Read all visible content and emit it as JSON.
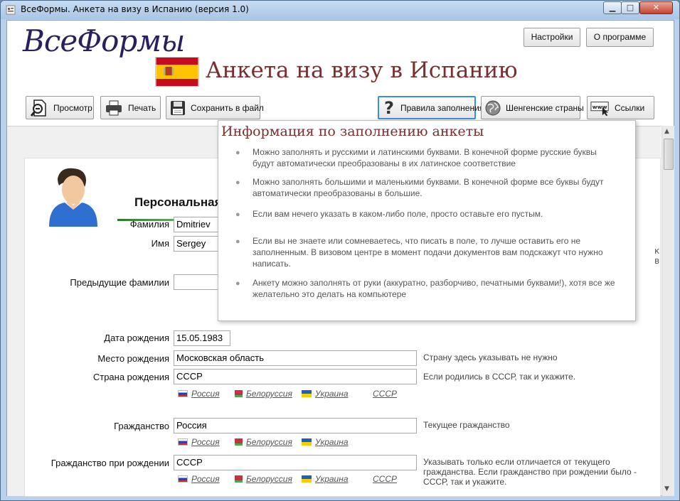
{
  "window": {
    "title": "ВсеФормы. Анкета на визу в Испанию (версия 1.0)",
    "min": "▁",
    "max": "□",
    "close": "✕"
  },
  "header": {
    "logo": "ВсеФормы",
    "settings": "Настройки",
    "about": "О программе",
    "page_title": "Анкета на визу в Испанию"
  },
  "toolbar": {
    "preview": "Просмотр",
    "print": "Печать",
    "save": "Сохранить в файл",
    "rules": "Правила заполнения",
    "schengen": "Шенгенские страны",
    "links": "Ссылки"
  },
  "section": {
    "title": "Персональная",
    "cut_text": "к в"
  },
  "form": {
    "surname_label": "Фамилия",
    "surname_value": "Dmitriev",
    "name_label": "Имя",
    "name_value": "Sergey",
    "prev_surnames_label": "Предыдущие фамилии",
    "prev_surnames_value": "",
    "birth_date_label": "Дата рождения",
    "birth_date_value": "15.05.1983",
    "birth_place_label": "Место рождения",
    "birth_place_value": "Московская область",
    "birth_place_hint": "Страну здесь указывать не нужно",
    "birth_country_label": "Страна рождения",
    "birth_country_value": "СССР",
    "birth_country_hint": "Если родились в СССР, так и укажите.",
    "citizenship_label": "Гражданство",
    "citizenship_value": "Россия",
    "citizenship_hint": "Текущее гражданство",
    "citizenship_birth_label": "Гражданство при рождении",
    "citizenship_birth_value": "СССР",
    "citizenship_birth_hint": "Указывать только если отличается от текущего гражданства. Если гражданство при рождении было - СССР, так и укажите."
  },
  "quick_links": {
    "russia": "Россия",
    "belarus": "Белоруссия",
    "ukraine": "Украина",
    "ussr": "СССР"
  },
  "popup": {
    "title": "Информация по заполнению анкеты",
    "items": [
      "Можно заполнять и русскими и латинскими буквами. В конечной форме русские буквы будут автоматически преобразованы в их латинское соответствие",
      "Можно заполнять большими и маленькими буквами. В конечной форме все буквы будут автоматически преобразованы в большие.",
      "Если вам нечего указать в каком-либо поле, просто оставьте его пустым.",
      "Если вы не знаете или сомневаетесь, что писать в поле, то лучше оставить его не заполненным. В визовом центре в момент подачи документов вам подскажут что нужно написать.",
      "Анкету можно заполнять от руки (аккуратно, разборчиво, печатными буквами!), хотя все же желательно это делать на компьютере"
    ]
  },
  "icons": {
    "preview": "magnifier-doc-icon",
    "print": "printer-icon",
    "save": "floppy-icon",
    "rules": "question-icon",
    "schengen": "globe-icon",
    "links": "www-cursor-icon"
  },
  "colors": {
    "accent_title": "#7a2e2e",
    "logo": "#2a2060",
    "active_button_border": "#3b8ee0"
  }
}
